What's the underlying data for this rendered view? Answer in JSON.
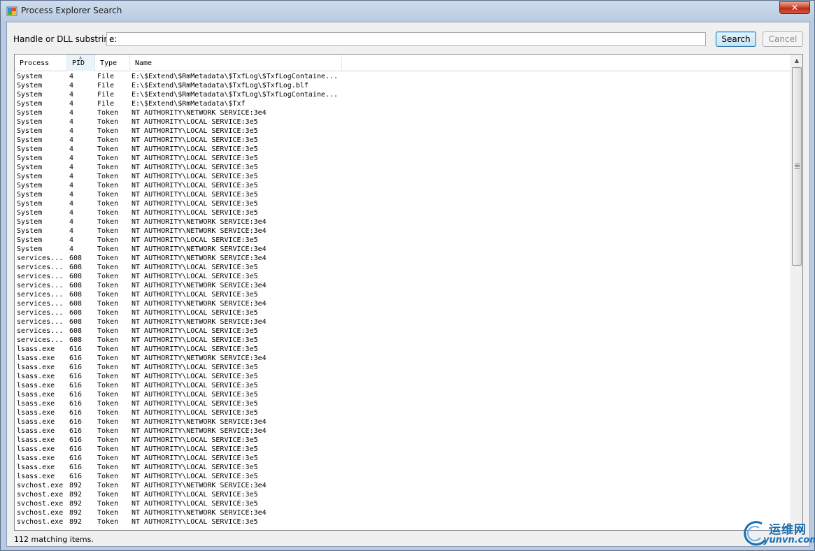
{
  "window": {
    "title": "Process Explorer Search",
    "close_label": "✕"
  },
  "search": {
    "label": "Handle or DLL substring:",
    "value": "e:",
    "search_button": "Search",
    "cancel_button": "Cancel"
  },
  "columns": [
    {
      "label": "Process"
    },
    {
      "label": "PID",
      "sorted": true
    },
    {
      "label": "Type"
    },
    {
      "label": "Name"
    }
  ],
  "rows": [
    [
      "System",
      "4",
      "File",
      "E:\\$Extend\\$RmMetadata\\$TxfLog\\$TxfLogContaine..."
    ],
    [
      "System",
      "4",
      "File",
      "E:\\$Extend\\$RmMetadata\\$TxfLog\\$TxfLog.blf"
    ],
    [
      "System",
      "4",
      "File",
      "E:\\$Extend\\$RmMetadata\\$TxfLog\\$TxfLogContaine..."
    ],
    [
      "System",
      "4",
      "File",
      "E:\\$Extend\\$RmMetadata\\$Txf"
    ],
    [
      "System",
      "4",
      "Token",
      "NT AUTHORITY\\NETWORK SERVICE:3e4"
    ],
    [
      "System",
      "4",
      "Token",
      "NT AUTHORITY\\LOCAL SERVICE:3e5"
    ],
    [
      "System",
      "4",
      "Token",
      "NT AUTHORITY\\LOCAL SERVICE:3e5"
    ],
    [
      "System",
      "4",
      "Token",
      "NT AUTHORITY\\LOCAL SERVICE:3e5"
    ],
    [
      "System",
      "4",
      "Token",
      "NT AUTHORITY\\LOCAL SERVICE:3e5"
    ],
    [
      "System",
      "4",
      "Token",
      "NT AUTHORITY\\LOCAL SERVICE:3e5"
    ],
    [
      "System",
      "4",
      "Token",
      "NT AUTHORITY\\LOCAL SERVICE:3e5"
    ],
    [
      "System",
      "4",
      "Token",
      "NT AUTHORITY\\LOCAL SERVICE:3e5"
    ],
    [
      "System",
      "4",
      "Token",
      "NT AUTHORITY\\LOCAL SERVICE:3e5"
    ],
    [
      "System",
      "4",
      "Token",
      "NT AUTHORITY\\LOCAL SERVICE:3e5"
    ],
    [
      "System",
      "4",
      "Token",
      "NT AUTHORITY\\LOCAL SERVICE:3e5"
    ],
    [
      "System",
      "4",
      "Token",
      "NT AUTHORITY\\LOCAL SERVICE:3e5"
    ],
    [
      "System",
      "4",
      "Token",
      "NT AUTHORITY\\NETWORK SERVICE:3e4"
    ],
    [
      "System",
      "4",
      "Token",
      "NT AUTHORITY\\NETWORK SERVICE:3e4"
    ],
    [
      "System",
      "4",
      "Token",
      "NT AUTHORITY\\LOCAL SERVICE:3e5"
    ],
    [
      "System",
      "4",
      "Token",
      "NT AUTHORITY\\NETWORK SERVICE:3e4"
    ],
    [
      "services...",
      "608",
      "Token",
      "NT AUTHORITY\\NETWORK SERVICE:3e4"
    ],
    [
      "services...",
      "608",
      "Token",
      "NT AUTHORITY\\LOCAL SERVICE:3e5"
    ],
    [
      "services...",
      "608",
      "Token",
      "NT AUTHORITY\\LOCAL SERVICE:3e5"
    ],
    [
      "services...",
      "608",
      "Token",
      "NT AUTHORITY\\NETWORK SERVICE:3e4"
    ],
    [
      "services...",
      "608",
      "Token",
      "NT AUTHORITY\\LOCAL SERVICE:3e5"
    ],
    [
      "services...",
      "608",
      "Token",
      "NT AUTHORITY\\NETWORK SERVICE:3e4"
    ],
    [
      "services...",
      "608",
      "Token",
      "NT AUTHORITY\\LOCAL SERVICE:3e5"
    ],
    [
      "services...",
      "608",
      "Token",
      "NT AUTHORITY\\NETWORK SERVICE:3e4"
    ],
    [
      "services...",
      "608",
      "Token",
      "NT AUTHORITY\\LOCAL SERVICE:3e5"
    ],
    [
      "services...",
      "608",
      "Token",
      "NT AUTHORITY\\LOCAL SERVICE:3e5"
    ],
    [
      "lsass.exe",
      "616",
      "Token",
      "NT AUTHORITY\\LOCAL SERVICE:3e5"
    ],
    [
      "lsass.exe",
      "616",
      "Token",
      "NT AUTHORITY\\NETWORK SERVICE:3e4"
    ],
    [
      "lsass.exe",
      "616",
      "Token",
      "NT AUTHORITY\\LOCAL SERVICE:3e5"
    ],
    [
      "lsass.exe",
      "616",
      "Token",
      "NT AUTHORITY\\LOCAL SERVICE:3e5"
    ],
    [
      "lsass.exe",
      "616",
      "Token",
      "NT AUTHORITY\\LOCAL SERVICE:3e5"
    ],
    [
      "lsass.exe",
      "616",
      "Token",
      "NT AUTHORITY\\LOCAL SERVICE:3e5"
    ],
    [
      "lsass.exe",
      "616",
      "Token",
      "NT AUTHORITY\\LOCAL SERVICE:3e5"
    ],
    [
      "lsass.exe",
      "616",
      "Token",
      "NT AUTHORITY\\LOCAL SERVICE:3e5"
    ],
    [
      "lsass.exe",
      "616",
      "Token",
      "NT AUTHORITY\\NETWORK SERVICE:3e4"
    ],
    [
      "lsass.exe",
      "616",
      "Token",
      "NT AUTHORITY\\NETWORK SERVICE:3e4"
    ],
    [
      "lsass.exe",
      "616",
      "Token",
      "NT AUTHORITY\\LOCAL SERVICE:3e5"
    ],
    [
      "lsass.exe",
      "616",
      "Token",
      "NT AUTHORITY\\LOCAL SERVICE:3e5"
    ],
    [
      "lsass.exe",
      "616",
      "Token",
      "NT AUTHORITY\\LOCAL SERVICE:3e5"
    ],
    [
      "lsass.exe",
      "616",
      "Token",
      "NT AUTHORITY\\LOCAL SERVICE:3e5"
    ],
    [
      "lsass.exe",
      "616",
      "Token",
      "NT AUTHORITY\\LOCAL SERVICE:3e5"
    ],
    [
      "svchost.exe",
      "892",
      "Token",
      "NT AUTHORITY\\NETWORK SERVICE:3e4"
    ],
    [
      "svchost.exe",
      "892",
      "Token",
      "NT AUTHORITY\\LOCAL SERVICE:3e5"
    ],
    [
      "svchost.exe",
      "892",
      "Token",
      "NT AUTHORITY\\LOCAL SERVICE:3e5"
    ],
    [
      "svchost.exe",
      "892",
      "Token",
      "NT AUTHORITY\\NETWORK SERVICE:3e4"
    ],
    [
      "svchost.exe",
      "892",
      "Token",
      "NT AUTHORITY\\LOCAL SERVICE:3e5"
    ]
  ],
  "status": {
    "text": "112 matching items."
  },
  "watermark": {
    "cn": "运维网",
    "en": "yunvn.com"
  },
  "icons": {
    "app": "process-explorer-icon",
    "close": "close-icon",
    "sort": "sort-ascending-icon",
    "scroll_up": "scroll-up-arrow-icon"
  },
  "colors": {
    "window_frame": "#b9cbe2",
    "search_button_border": "#3c7fb1",
    "watermark": "#1b6fae"
  }
}
